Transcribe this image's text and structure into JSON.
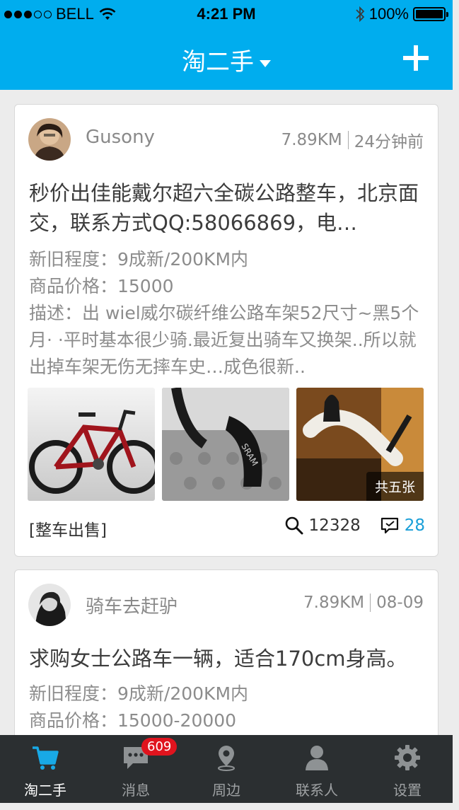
{
  "status_bar": {
    "carrier": "BELL",
    "time": "4:21 PM",
    "battery": "100%"
  },
  "nav": {
    "title": "淘二手",
    "add_icon": "plus-icon"
  },
  "posts": [
    {
      "username": "Gusony",
      "distance": "7.89KM",
      "time": "24分钟前",
      "title": "秒价出佳能戴尔超六全碳公路整车，北京面交，联系方式QQ:58066869，电…",
      "condition": "新旧程度：9成新/200KM内",
      "price": "商品价格：15000",
      "description": "描述：出 wiel威尔碳纤维公路车架52尺寸~黑5个月· ·平时基本很少骑.最近复出骑车又换架..所以就出掉车架无伤无摔车史…成色很新..",
      "image_count": "共五张",
      "category": "[整车出售]",
      "views": "12328",
      "comments": "28"
    },
    {
      "username": "骑车去赶驴",
      "distance": "7.89KM",
      "time": "08-09",
      "title": "求购女士公路车一辆，适合170cm身高。",
      "condition": "新旧程度：9成新/200KM内",
      "price": "商品价格：15000-20000"
    }
  ],
  "tabs": [
    {
      "label": "淘二手",
      "icon": "cart-icon",
      "active": true
    },
    {
      "label": "消息",
      "icon": "chat-icon",
      "badge": "609"
    },
    {
      "label": "周边",
      "icon": "location-pin-icon"
    },
    {
      "label": "联系人",
      "icon": "person-icon"
    },
    {
      "label": "设置",
      "icon": "gear-icon"
    }
  ],
  "colors": {
    "brand": "#00adee",
    "tabbar": "#2b2f31",
    "badge": "#e0141e",
    "comment_accent": "#1a9fd8"
  }
}
